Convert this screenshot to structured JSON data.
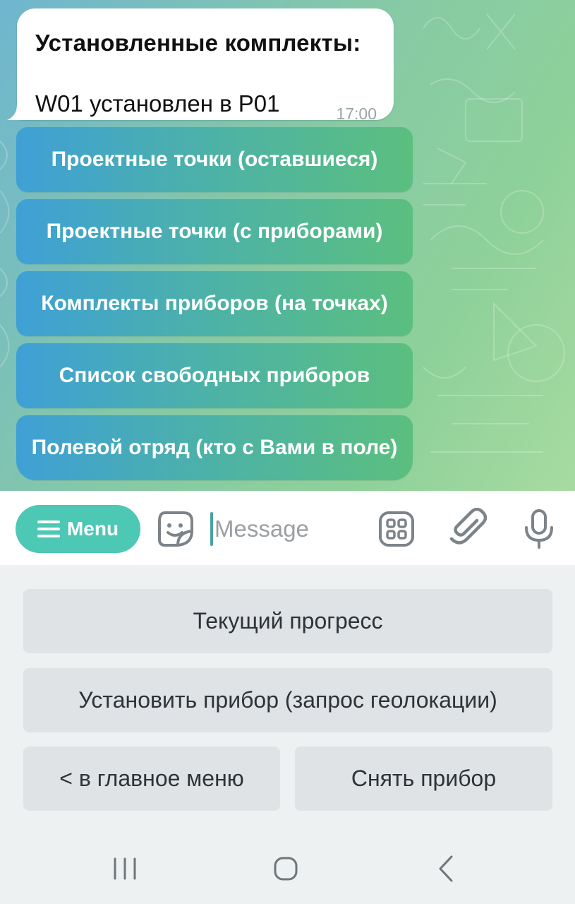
{
  "message": {
    "title": "Установленные комплекты:",
    "line": "W01 установлен в P01",
    "time": "17:00"
  },
  "inline_buttons": [
    {
      "label": "Проектные точки (оставшиеся)"
    },
    {
      "label": "Проектные точки (с приборами)"
    },
    {
      "label": "Комплекты приборов (на точках)"
    },
    {
      "label": "Список свободных приборов"
    },
    {
      "label": "Полевой отряд (кто с Вами в поле)"
    }
  ],
  "input_bar": {
    "menu_label": "Menu",
    "placeholder": "Message"
  },
  "keyboard": [
    {
      "label": "Текущий прогресс"
    },
    {
      "label": "Установить прибор (запрос геолокации)"
    },
    {
      "label": "< в главное меню"
    },
    {
      "label": "Снять прибор"
    }
  ],
  "colors": {
    "accent": "#4cc8b5",
    "inline_button_start": "#3fa0d6",
    "inline_button_end": "#5bbf7f"
  },
  "icons": [
    "sticker-icon",
    "apps-icon",
    "paperclip-icon",
    "microphone-icon",
    "recent-apps-icon",
    "home-icon",
    "back-icon"
  ]
}
